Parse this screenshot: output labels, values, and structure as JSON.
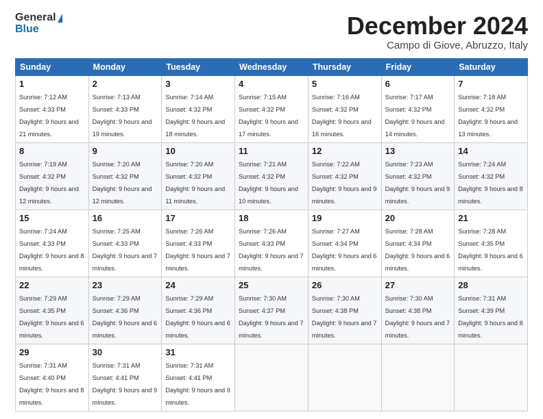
{
  "logo": {
    "general": "General",
    "blue": "Blue"
  },
  "header": {
    "month": "December 2024",
    "location": "Campo di Giove, Abruzzo, Italy"
  },
  "days_of_week": [
    "Sunday",
    "Monday",
    "Tuesday",
    "Wednesday",
    "Thursday",
    "Friday",
    "Saturday"
  ],
  "weeks": [
    [
      {
        "day": "1",
        "sunrise": "7:12 AM",
        "sunset": "4:33 PM",
        "daylight": "9 hours and 21 minutes."
      },
      {
        "day": "2",
        "sunrise": "7:13 AM",
        "sunset": "4:33 PM",
        "daylight": "9 hours and 19 minutes."
      },
      {
        "day": "3",
        "sunrise": "7:14 AM",
        "sunset": "4:32 PM",
        "daylight": "9 hours and 18 minutes."
      },
      {
        "day": "4",
        "sunrise": "7:15 AM",
        "sunset": "4:32 PM",
        "daylight": "9 hours and 17 minutes."
      },
      {
        "day": "5",
        "sunrise": "7:16 AM",
        "sunset": "4:32 PM",
        "daylight": "9 hours and 16 minutes."
      },
      {
        "day": "6",
        "sunrise": "7:17 AM",
        "sunset": "4:32 PM",
        "daylight": "9 hours and 14 minutes."
      },
      {
        "day": "7",
        "sunrise": "7:18 AM",
        "sunset": "4:32 PM",
        "daylight": "9 hours and 13 minutes."
      }
    ],
    [
      {
        "day": "8",
        "sunrise": "7:19 AM",
        "sunset": "4:32 PM",
        "daylight": "9 hours and 12 minutes."
      },
      {
        "day": "9",
        "sunrise": "7:20 AM",
        "sunset": "4:32 PM",
        "daylight": "9 hours and 12 minutes."
      },
      {
        "day": "10",
        "sunrise": "7:20 AM",
        "sunset": "4:32 PM",
        "daylight": "9 hours and 11 minutes."
      },
      {
        "day": "11",
        "sunrise": "7:21 AM",
        "sunset": "4:32 PM",
        "daylight": "9 hours and 10 minutes."
      },
      {
        "day": "12",
        "sunrise": "7:22 AM",
        "sunset": "4:32 PM",
        "daylight": "9 hours and 9 minutes."
      },
      {
        "day": "13",
        "sunrise": "7:23 AM",
        "sunset": "4:32 PM",
        "daylight": "9 hours and 9 minutes."
      },
      {
        "day": "14",
        "sunrise": "7:24 AM",
        "sunset": "4:32 PM",
        "daylight": "9 hours and 8 minutes."
      }
    ],
    [
      {
        "day": "15",
        "sunrise": "7:24 AM",
        "sunset": "4:33 PM",
        "daylight": "9 hours and 8 minutes."
      },
      {
        "day": "16",
        "sunrise": "7:25 AM",
        "sunset": "4:33 PM",
        "daylight": "9 hours and 7 minutes."
      },
      {
        "day": "17",
        "sunrise": "7:26 AM",
        "sunset": "4:33 PM",
        "daylight": "9 hours and 7 minutes."
      },
      {
        "day": "18",
        "sunrise": "7:26 AM",
        "sunset": "4:33 PM",
        "daylight": "9 hours and 7 minutes."
      },
      {
        "day": "19",
        "sunrise": "7:27 AM",
        "sunset": "4:34 PM",
        "daylight": "9 hours and 6 minutes."
      },
      {
        "day": "20",
        "sunrise": "7:28 AM",
        "sunset": "4:34 PM",
        "daylight": "9 hours and 6 minutes."
      },
      {
        "day": "21",
        "sunrise": "7:28 AM",
        "sunset": "4:35 PM",
        "daylight": "9 hours and 6 minutes."
      }
    ],
    [
      {
        "day": "22",
        "sunrise": "7:29 AM",
        "sunset": "4:35 PM",
        "daylight": "9 hours and 6 minutes."
      },
      {
        "day": "23",
        "sunrise": "7:29 AM",
        "sunset": "4:36 PM",
        "daylight": "9 hours and 6 minutes."
      },
      {
        "day": "24",
        "sunrise": "7:29 AM",
        "sunset": "4:36 PM",
        "daylight": "9 hours and 6 minutes."
      },
      {
        "day": "25",
        "sunrise": "7:30 AM",
        "sunset": "4:37 PM",
        "daylight": "9 hours and 7 minutes."
      },
      {
        "day": "26",
        "sunrise": "7:30 AM",
        "sunset": "4:38 PM",
        "daylight": "9 hours and 7 minutes."
      },
      {
        "day": "27",
        "sunrise": "7:30 AM",
        "sunset": "4:38 PM",
        "daylight": "9 hours and 7 minutes."
      },
      {
        "day": "28",
        "sunrise": "7:31 AM",
        "sunset": "4:39 PM",
        "daylight": "9 hours and 8 minutes."
      }
    ],
    [
      {
        "day": "29",
        "sunrise": "7:31 AM",
        "sunset": "4:40 PM",
        "daylight": "9 hours and 8 minutes."
      },
      {
        "day": "30",
        "sunrise": "7:31 AM",
        "sunset": "4:41 PM",
        "daylight": "9 hours and 9 minutes."
      },
      {
        "day": "31",
        "sunrise": "7:31 AM",
        "sunset": "4:41 PM",
        "daylight": "9 hours and 9 minutes."
      },
      null,
      null,
      null,
      null
    ]
  ]
}
